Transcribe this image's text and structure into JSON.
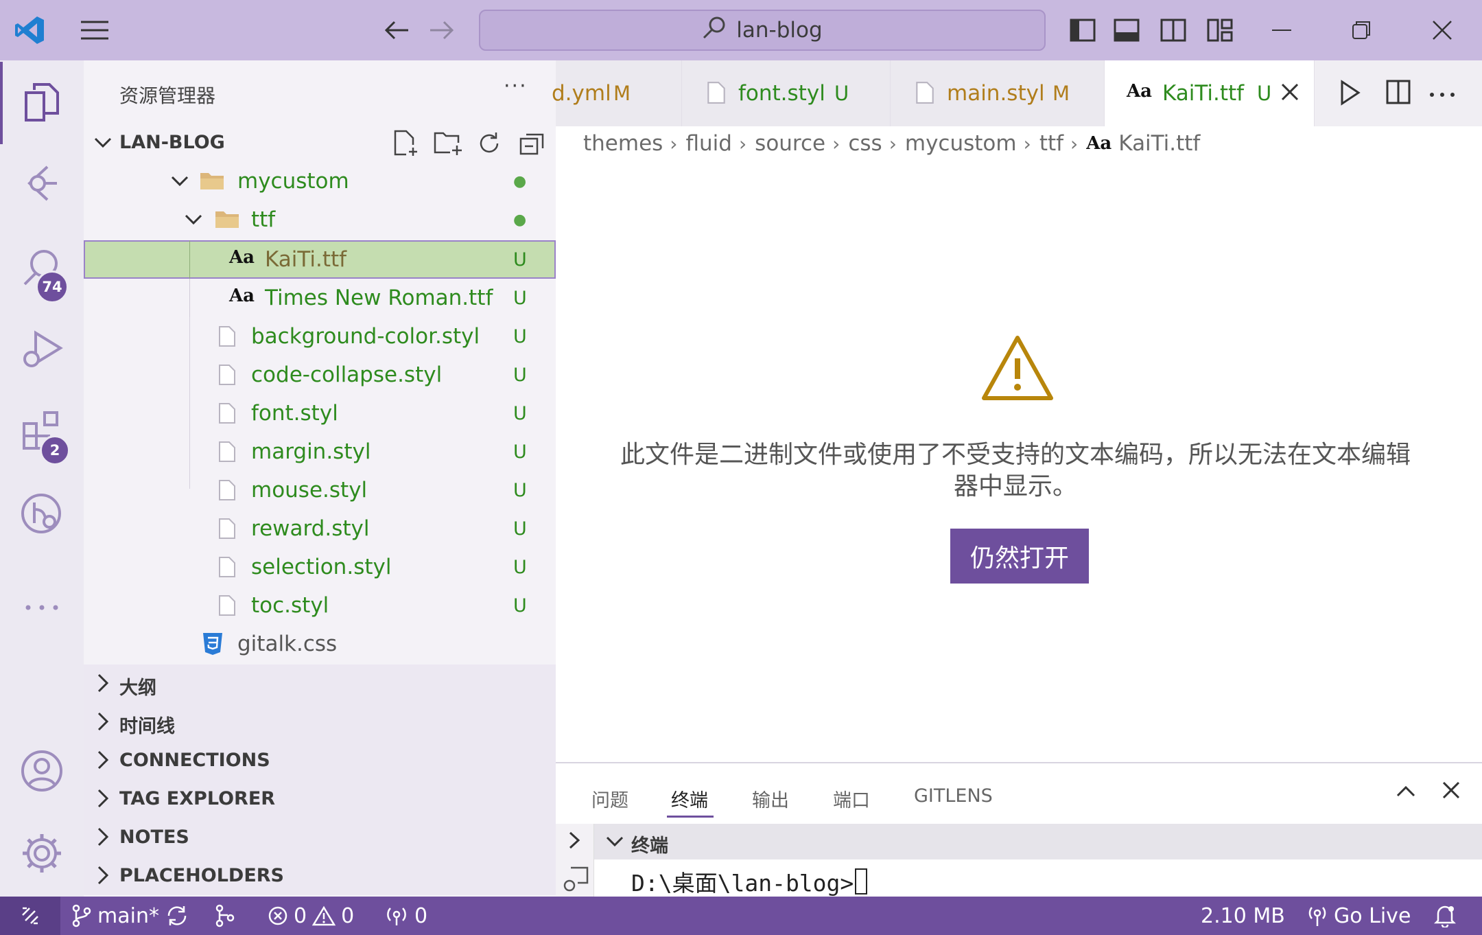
{
  "window": {
    "search_text": "lan-blog"
  },
  "activity": {
    "search_badge": "74",
    "extensions_badge": "2"
  },
  "explorer": {
    "title": "资源管理器",
    "more": "···",
    "section_title": "LAN-BLOG",
    "tree": [
      {
        "label": "mycustom",
        "status": "●"
      },
      {
        "label": "ttf",
        "status": "●"
      },
      {
        "icon_text": "Aa",
        "label": "KaiTi.ttf",
        "status": "U"
      },
      {
        "icon_text": "Aa",
        "label": "Times New Roman.ttf",
        "status": "U"
      },
      {
        "label": "background-color.styl",
        "status": "U"
      },
      {
        "label": "code-collapse.styl",
        "status": "U"
      },
      {
        "label": "font.styl",
        "status": "U"
      },
      {
        "label": "margin.styl",
        "status": "U"
      },
      {
        "label": "mouse.styl",
        "status": "U"
      },
      {
        "label": "reward.styl",
        "status": "U"
      },
      {
        "label": "selection.styl",
        "status": "U"
      },
      {
        "label": "toc.styl",
        "status": "U"
      },
      {
        "label": "gitalk.css",
        "status": ""
      }
    ],
    "sections": [
      "大纲",
      "时间线",
      "CONNECTIONS",
      "TAG EXPLORER",
      "NOTES",
      "PLACEHOLDERS"
    ]
  },
  "tabs": [
    {
      "label": "d.yml",
      "status": "M"
    },
    {
      "label": "font.styl",
      "status": "U"
    },
    {
      "label": "main.styl",
      "status": "M"
    },
    {
      "icon_text": "Aa",
      "label": "KaiTi.ttf",
      "status": "U"
    }
  ],
  "breadcrumb": [
    "themes",
    "fluid",
    "source",
    "css",
    "mycustom",
    "ttf",
    "KaiTi.ttf"
  ],
  "breadcrumb_icon": "Aa",
  "editor": {
    "message": "此文件是二进制文件或使用了不受支持的文本编码，所以无法在文本编辑器中显示。",
    "open_anyway": "仍然打开"
  },
  "panel": {
    "tabs": [
      "问题",
      "终端",
      "输出",
      "端口",
      "GITLENS"
    ],
    "terminal_title": "终端",
    "terminal_prompt": "D:\\桌面\\lan-blog>"
  },
  "status": {
    "branch": "main*",
    "errors": "0",
    "warnings": "0",
    "ports": "0",
    "file_size": "2.10 MB",
    "go_live": "Go Live"
  },
  "colors": {
    "accent": "#6e4f9d",
    "titlebar": "#c8b9df",
    "untracked": "#2e8b1e",
    "modified": "#b07d1b"
  }
}
